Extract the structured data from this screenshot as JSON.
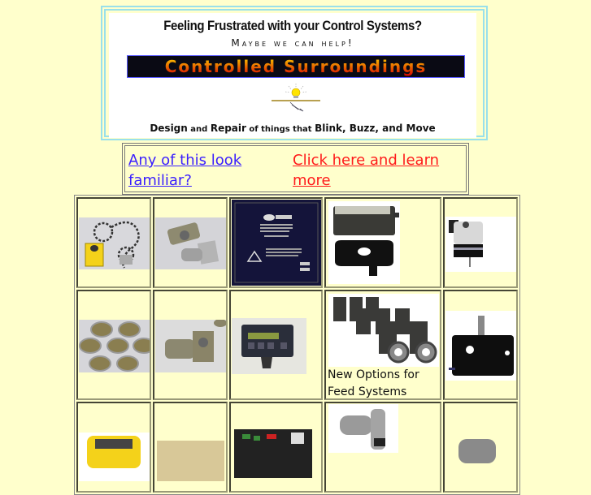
{
  "banner": {
    "headline": "Feeling Frustrated with your Control Systems?",
    "subheadline": "Maybe we can help!",
    "logo_text": "Controlled Surroundings",
    "tagline_parts": [
      "Design",
      " and ",
      "Repair",
      " of things that ",
      "Blink, Buzz, and Move"
    ],
    "icon": "lightbulb-on-tray-icon"
  },
  "links": {
    "familiar": "Any of this look familiar?",
    "learn_more": "Click here and learn more",
    "familiar_color": "#3a1fff",
    "learn_more_color": "#ff1a1a"
  },
  "grid": {
    "rows": [
      [
        {
          "subject": "yellow box with chain and sprockets"
        },
        {
          "subject": "metal pipe fittings"
        },
        {
          "subject": "Ingersoll-Rand control panel"
        },
        {
          "subject": "controller and mounting plate"
        },
        {
          "subject": "cylindrical motor"
        }
      ],
      [
        {
          "subject": "brass cups"
        },
        {
          "subject": "pipe fitting"
        },
        {
          "subject": "digital control keypad"
        },
        {
          "subject": "feed system solenoids",
          "caption": "New Options for Feed Systems"
        },
        {
          "subject": "black cylinder housing"
        }
      ],
      [
        {
          "subject": "yellow device"
        },
        {
          "subject": "tan component"
        },
        {
          "subject": "circuit board"
        },
        {
          "subject": "metal pipe elbow"
        },
        {
          "subject": "metal coupling"
        }
      ]
    ]
  },
  "colors": {
    "page_background": "#ffffcc",
    "banner_border": "#99e0ea"
  }
}
